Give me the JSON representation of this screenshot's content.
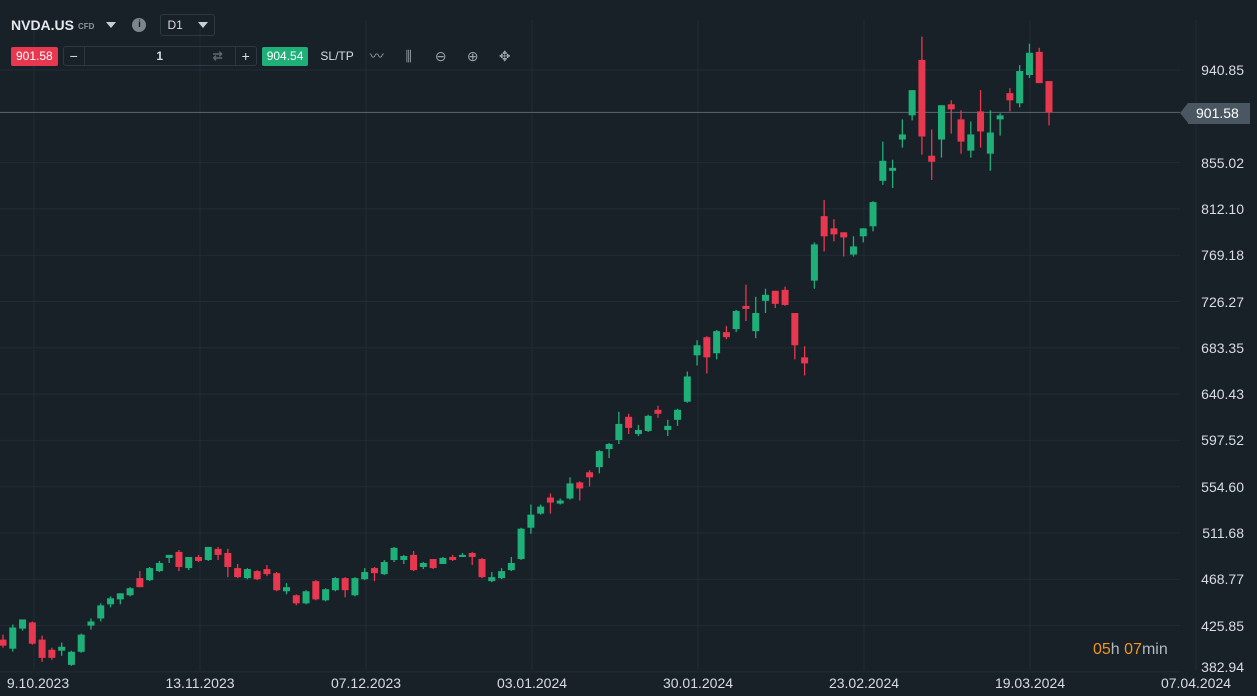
{
  "header": {
    "symbol": "NVDA.US",
    "type": "CFD",
    "timeframe": "D1"
  },
  "trade": {
    "sell_price": "901.58",
    "buy_price": "904.54",
    "quantity": "1",
    "minus": "−",
    "plus": "+",
    "swap_icon": "⇄",
    "sltp": "SL/TP"
  },
  "tools": {
    "line": "〰",
    "candles": "⫼",
    "zoom_out": "⊖",
    "zoom_in": "⊕",
    "move": "✥"
  },
  "colors": {
    "up": "#1fb07a",
    "down": "#e8384f",
    "grid": "#222c35",
    "price_line": "#5a6670"
  },
  "timer": {
    "h": "05",
    "h_unit": "h",
    "m": "07",
    "m_unit": "min"
  },
  "current_price": "901.58",
  "chart_data": {
    "type": "candlestick",
    "y_ticks": [
      "940.85",
      "855.02",
      "812.10",
      "769.18",
      "726.27",
      "683.35",
      "640.43",
      "597.52",
      "554.60",
      "511.68",
      "468.77",
      "425.85",
      "382.94"
    ],
    "x_ticks": [
      "9.10.2023",
      "13.11.2023",
      "07.12.2023",
      "03.01.2024",
      "30.01.2024",
      "23.02.2024",
      "19.03.2024",
      "07.04.2024"
    ],
    "ohlc": [
      [
        412.9,
        417.5,
        405.4,
        407.3
      ],
      [
        404.5,
        426.9,
        401.7,
        424.1
      ],
      [
        423.1,
        431.6,
        421.3,
        431.6
      ],
      [
        428.8,
        429.7,
        408.2,
        409.1
      ],
      [
        412.9,
        416.6,
        392.3,
        396.0
      ],
      [
        403.5,
        405.4,
        394.2,
        396.0
      ],
      [
        402.6,
        410.1,
        397.9,
        406.3
      ],
      [
        389.5,
        402.6,
        388.6,
        401.6
      ],
      [
        401.6,
        418.5,
        400.7,
        417.5
      ],
      [
        425.9,
        432.5,
        422.2,
        429.7
      ],
      [
        432.5,
        446.5,
        429.7,
        444.6
      ],
      [
        445.6,
        453.0,
        442.8,
        451.2
      ],
      [
        450.2,
        455.8,
        445.6,
        455.8
      ],
      [
        454.0,
        461.5,
        453.0,
        460.5
      ],
      [
        469.9,
        476.4,
        461.5,
        461.5
      ],
      [
        468.0,
        480.2,
        467.1,
        479.2
      ],
      [
        476.4,
        485.8,
        475.5,
        483.9
      ],
      [
        488.6,
        491.4,
        483.9,
        491.4
      ],
      [
        494.2,
        496.0,
        476.4,
        480.2
      ],
      [
        479.2,
        489.5,
        477.3,
        489.5
      ],
      [
        489.5,
        491.4,
        484.8,
        485.8
      ],
      [
        486.7,
        498.8,
        485.8,
        498.8
      ],
      [
        497.0,
        498.8,
        486.7,
        491.4
      ],
      [
        493.2,
        497.0,
        470.8,
        480.2
      ],
      [
        479.2,
        483.0,
        469.9,
        470.8
      ],
      [
        469.9,
        479.2,
        468.9,
        478.3
      ],
      [
        476.4,
        477.3,
        468.0,
        468.9
      ],
      [
        478.3,
        482.0,
        471.7,
        473.6
      ],
      [
        474.5,
        475.5,
        457.7,
        458.7
      ],
      [
        457.7,
        465.2,
        454.9,
        461.5
      ],
      [
        454.0,
        454.9,
        444.6,
        446.5
      ],
      [
        446.5,
        458.7,
        445.6,
        457.7
      ],
      [
        467.1,
        468.0,
        449.3,
        450.2
      ],
      [
        449.3,
        460.5,
        448.4,
        459.6
      ],
      [
        458.7,
        470.8,
        457.7,
        469.9
      ],
      [
        469.9,
        470.8,
        452.1,
        458.7
      ],
      [
        454.0,
        470.8,
        453.0,
        469.9
      ],
      [
        468.9,
        479.2,
        468.0,
        475.5
      ],
      [
        479.2,
        480.2,
        467.1,
        474.5
      ],
      [
        473.6,
        486.7,
        472.7,
        484.8
      ],
      [
        486.7,
        498.8,
        484.8,
        497.9
      ],
      [
        486.7,
        491.4,
        483.0,
        490.4
      ],
      [
        491.4,
        495.1,
        476.4,
        477.3
      ],
      [
        480.2,
        484.8,
        478.3,
        483.9
      ],
      [
        487.6,
        487.6,
        478.3,
        479.2
      ],
      [
        483.0,
        489.5,
        483.0,
        488.6
      ],
      [
        489.5,
        491.4,
        485.8,
        486.7
      ],
      [
        489.5,
        493.2,
        489.5,
        491.4
      ],
      [
        493.2,
        494.2,
        482.0,
        489.5
      ],
      [
        487.6,
        488.6,
        469.9,
        470.8
      ],
      [
        467.1,
        475.5,
        466.1,
        470.8
      ],
      [
        469.9,
        479.2,
        468.9,
        476.4
      ],
      [
        477.3,
        489.5,
        476.4,
        483.9
      ],
      [
        487.6,
        516.6,
        486.7,
        515.7
      ],
      [
        516.6,
        538.1,
        511.0,
        528.7
      ],
      [
        529.7,
        538.1,
        528.7,
        536.2
      ],
      [
        544.6,
        548.4,
        529.7,
        539.9
      ],
      [
        539.0,
        543.7,
        538.1,
        541.8
      ],
      [
        543.7,
        563.3,
        542.7,
        557.7
      ],
      [
        558.6,
        559.6,
        541.8,
        553.0
      ],
      [
        568.0,
        569.9,
        554.9,
        563.3
      ],
      [
        572.7,
        588.5,
        567.0,
        587.6
      ],
      [
        589.5,
        595.1,
        581.1,
        594.2
      ],
      [
        597.9,
        624.1,
        594.2,
        612.8
      ],
      [
        619.4,
        622.2,
        603.5,
        609.1
      ],
      [
        603.5,
        611.9,
        601.6,
        607.2
      ],
      [
        606.3,
        621.3,
        605.3,
        620.3
      ],
      [
        625.9,
        629.7,
        618.5,
        622.2
      ],
      [
        607.2,
        616.6,
        601.6,
        611.0
      ],
      [
        616.6,
        626.9,
        611.0,
        625.9
      ],
      [
        633.4,
        661.4,
        632.5,
        656.8
      ],
      [
        676.4,
        690.4,
        667.0,
        685.7
      ],
      [
        693.2,
        694.1,
        659.6,
        674.5
      ],
      [
        678.3,
        699.8,
        672.7,
        698.8
      ],
      [
        697.9,
        703.5,
        691.3,
        693.2
      ],
      [
        700.7,
        718.5,
        697.9,
        717.5
      ],
      [
        722.2,
        741.8,
        708.2,
        719.4
      ],
      [
        698.8,
        730.6,
        692.3,
        715.6
      ],
      [
        726.9,
        738.1,
        715.6,
        732.5
      ],
      [
        736.2,
        736.2,
        720.3,
        724.1
      ],
      [
        737.1,
        740.0,
        722.2,
        723.1
      ],
      [
        715.6,
        715.6,
        672.7,
        685.7
      ],
      [
        674.5,
        684.8,
        657.7,
        668.9
      ],
      [
        745.6,
        781.1,
        738.1,
        779.2
      ],
      [
        805.4,
        820.3,
        772.7,
        786.7
      ],
      [
        794.1,
        802.6,
        782.0,
        788.5
      ],
      [
        790.4,
        790.4,
        768.0,
        785.7
      ],
      [
        769.8,
        786.7,
        768.0,
        777.3
      ],
      [
        786.7,
        794.1,
        781.1,
        794.1
      ],
      [
        796.0,
        819.3,
        791.3,
        818.4
      ],
      [
        838.1,
        874.5,
        834.4,
        856.7
      ],
      [
        847.4,
        857.7,
        831.5,
        850.2
      ],
      [
        876.4,
        895.1,
        868.9,
        881.1
      ],
      [
        898.8,
        922.2,
        894.1,
        922.2
      ],
      [
        950.2,
        971.7,
        862.4,
        879.2
      ],
      [
        861.4,
        885.7,
        839.0,
        855.8
      ],
      [
        876.4,
        908.2,
        859.6,
        908.2
      ],
      [
        909.1,
        912.8,
        881.9,
        904.4
      ],
      [
        895.1,
        903.5,
        863.3,
        874.5
      ],
      [
        866.1,
        893.2,
        859.6,
        881.1
      ],
      [
        902.5,
        922.2,
        868.9,
        883.9
      ],
      [
        863.3,
        903.5,
        847.4,
        882.9
      ],
      [
        895.1,
        900.7,
        880.1,
        898.8
      ],
      [
        919.4,
        924.0,
        902.5,
        912.8
      ],
      [
        910.0,
        945.5,
        906.3,
        939.9
      ],
      [
        936.2,
        965.2,
        933.4,
        956.8
      ],
      [
        957.7,
        961.4,
        928.7,
        928.7
      ],
      [
        930.6,
        930.6,
        889.5,
        901.58
      ]
    ]
  }
}
